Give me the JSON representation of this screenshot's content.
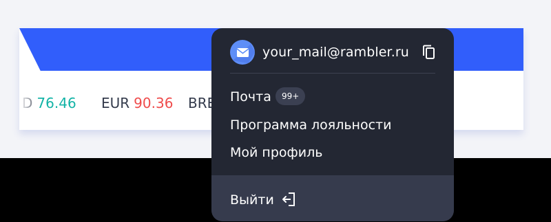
{
  "rates": [
    {
      "code": "D",
      "value": "76.46",
      "trend": "up"
    },
    {
      "code": "EUR",
      "value": "90.36",
      "trend": "down"
    },
    {
      "code": "BRE",
      "value": "",
      "trend": ""
    }
  ],
  "account_menu": {
    "email": "your_mail@rambler.ru",
    "avatar_color": "#5e8ef7",
    "items": [
      {
        "label": "Почта",
        "badge": "99+"
      },
      {
        "label": "Программа лояльности"
      },
      {
        "label": "Мой профиль"
      }
    ],
    "logout_label": "Выйти"
  },
  "colors": {
    "brand_blue": "#315efb",
    "menu_bg": "#232733",
    "rate_up": "#12b3a6",
    "rate_down": "#ef4b4b"
  }
}
